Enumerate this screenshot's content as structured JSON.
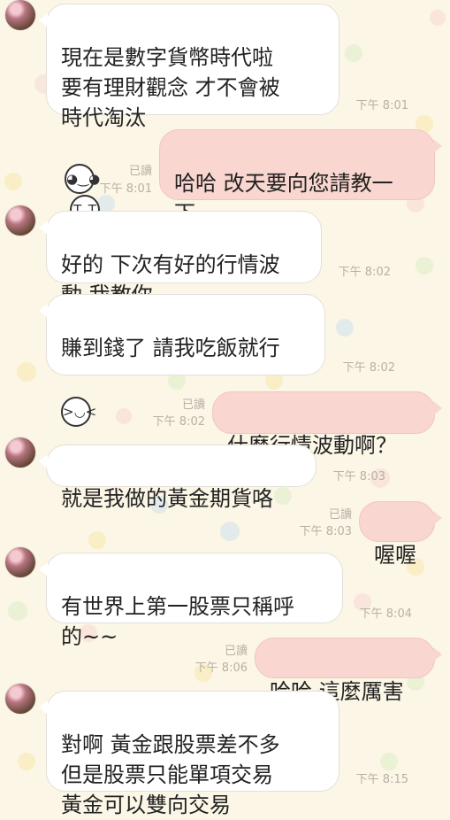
{
  "colors": {
    "incoming_bubble": "#ffffff",
    "outgoing_bubble": "#f9d6cf",
    "meta_text": "#b8b0a6",
    "background": "#fbf6e6"
  },
  "messages": [
    {
      "dir": "in",
      "avatar": true,
      "text": "現在是數字貨幣時代啦\n要有理財觀念  才不會被\n時代淘汰",
      "emojis": [
        "smiling-face-icon",
        "crying-face-icon"
      ],
      "time": "下午 8:01"
    },
    {
      "dir": "out",
      "text": "哈哈 改天要向您請教一\n下",
      "emojis": [
        "rolling-laugh-icon"
      ],
      "read": "已讀",
      "time": "下午 8:01"
    },
    {
      "dir": "in",
      "avatar": true,
      "text": "好的 下次有好的行情波\n動  我教你",
      "time": "下午 8:02"
    },
    {
      "dir": "in",
      "text": "賺到錢了  請我吃飯就行",
      "emojis": [
        "grinning-face-icon"
      ],
      "time": "下午 8:02"
    },
    {
      "dir": "out",
      "text": "什麼行情波動啊？",
      "read": "已讀",
      "time": "下午 8:02"
    },
    {
      "dir": "in",
      "avatar": true,
      "text": "就是我做的黃金期貨咯",
      "time": "下午 8:03"
    },
    {
      "dir": "out",
      "text": "喔喔",
      "read": "已讀",
      "time": "下午 8:03"
    },
    {
      "dir": "in",
      "avatar": true,
      "text": "有世界上第一股票只稱呼\n的~~",
      "time": "下午 8:04"
    },
    {
      "dir": "out",
      "text": "哈哈 這麼厲害",
      "read": "已讀",
      "time": "下午 8:06"
    },
    {
      "dir": "in",
      "avatar": true,
      "text": "對啊  黃金跟股票差不多\n但是股票只能單項交易\n黃金可以雙向交易",
      "time": "下午 8:15"
    }
  ]
}
